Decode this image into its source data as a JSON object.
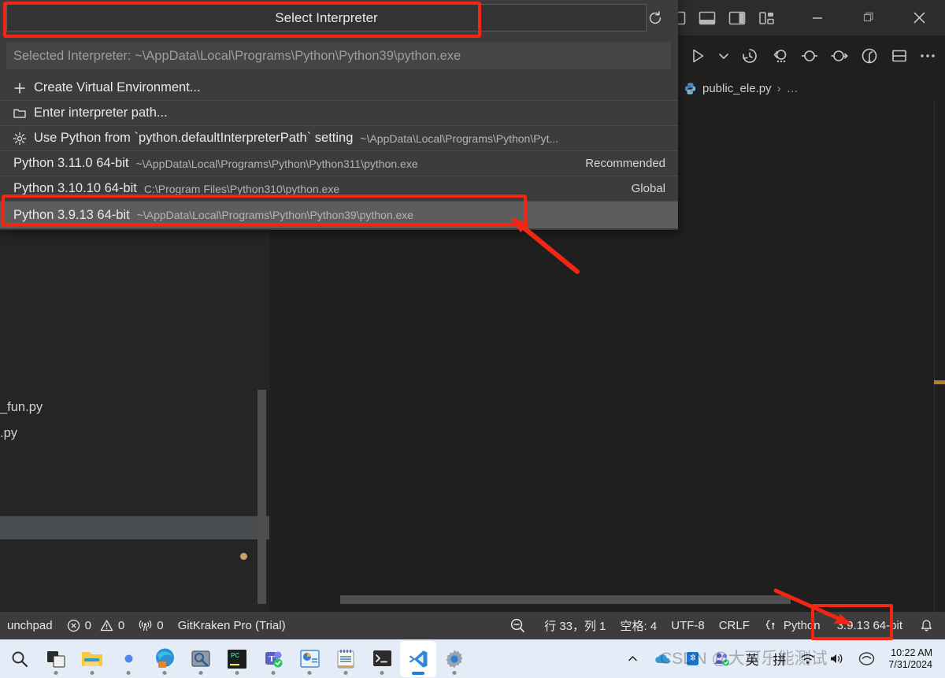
{
  "window": {
    "layout_icons": [
      "toggle-primary-sidebar-icon",
      "toggle-panel-icon",
      "toggle-secondary-sidebar-icon",
      "customize-layout-icon"
    ],
    "minimize_label": "─",
    "maximize_label": "❐",
    "close_label": "✕"
  },
  "toolbar": {
    "run_label": "run-python-file",
    "run_dropdown_label": "run-options",
    "icons": [
      "run-icon",
      "chevron-down-icon",
      "timeline-icon",
      "run-by-line-icon",
      "step-icon",
      "step-over-icon",
      "debug-icon",
      "split-editor-icon",
      "more-actions-icon"
    ]
  },
  "breadcrumb": {
    "leading_chevron": "›",
    "file_icon": "python-file-icon",
    "file": "public_ele.py",
    "separator": "›",
    "ellipsis": "…"
  },
  "quickpick": {
    "title": "Select Interpreter",
    "refresh_icon": "refresh-icon",
    "selected_interpreter": "Selected Interpreter: ~\\AppData\\Local\\Programs\\Python\\Python39\\python.exe",
    "items": [
      {
        "icon": "plus-icon",
        "label": "Create Virtual Environment...",
        "description": "",
        "right": "",
        "selected": false
      },
      {
        "icon": "folder-icon",
        "label": "Enter interpreter path...",
        "description": "",
        "right": "",
        "selected": false
      },
      {
        "icon": "gear-icon",
        "label": "Use Python from `python.defaultInterpreterPath` setting",
        "description": "~\\AppData\\Local\\Programs\\Python\\Pyt...",
        "right": "",
        "selected": false
      },
      {
        "icon": "",
        "label": "Python 3.11.0 64-bit",
        "description": "~\\AppData\\Local\\Programs\\Python\\Python311\\python.exe",
        "right": "Recommended",
        "selected": false
      },
      {
        "icon": "",
        "label": "Python 3.10.10 64-bit",
        "description": "C:\\Program Files\\Python310\\python.exe",
        "right": "Global",
        "selected": false
      },
      {
        "icon": "",
        "label": "Python 3.9.13 64-bit",
        "description": "~\\AppData\\Local\\Programs\\Python\\Python39\\python.exe",
        "right": "",
        "selected": true
      }
    ]
  },
  "sidebar": {
    "files": [
      "_fun.py",
      ".py"
    ]
  },
  "statusbar": {
    "launchpad": "unchpad",
    "errors_icon": "error-circle-icon",
    "errors": "0",
    "warnings_icon": "warning-triangle-icon",
    "warnings": "0",
    "ports_icon": "radio-tower-icon",
    "ports": "0",
    "gitkraken": "GitKraken Pro (Trial)",
    "zoom_out_icon": "zoom-out-icon",
    "cursor_position": "行 33，列 1",
    "indentation": "空格: 4",
    "encoding": "UTF-8",
    "eol": "CRLF",
    "language_icon": "python-brackets-icon",
    "language": "Python",
    "interpreter": "3.9.13 64-bit",
    "bell_icon": "bell-icon"
  },
  "taskbar": {
    "apps": [
      {
        "name": "search-icon",
        "running": false
      },
      {
        "name": "task-view-icon",
        "running": true
      },
      {
        "name": "file-explorer-icon",
        "running": true
      },
      {
        "name": "microsoft-365-icon",
        "running": true
      },
      {
        "name": "microsoft-edge-icon",
        "running": true
      },
      {
        "name": "snipaste-icon",
        "running": true
      },
      {
        "name": "pycharm-icon",
        "running": true
      },
      {
        "name": "microsoft-teams-icon",
        "running": true
      },
      {
        "name": "powerpoint-icon",
        "running": true
      },
      {
        "name": "notepad-icon",
        "running": true
      },
      {
        "name": "terminal-icon",
        "running": true
      },
      {
        "name": "vscode-icon",
        "running": true,
        "active": true
      },
      {
        "name": "settings-icon",
        "running": true
      }
    ],
    "tray": {
      "chevron_up": "show-hidden-icons",
      "onedrive": "onedrive-icon",
      "bluetooth": "bluetooth-icon",
      "teams": "teams-tray-icon",
      "ime_lang": "英",
      "ime_mode": "拼",
      "network": "network-icon",
      "volume": "volume-icon",
      "ime_tool": "ime-tool-icon"
    },
    "clock": {
      "time": "10:22 AM",
      "date": "7/31/2024"
    }
  },
  "watermark": "CSDN @大可乐能测试",
  "colors": {
    "annotation": "#f22613",
    "editor_bg": "#1f1f1f",
    "sidebar_bg": "#252526",
    "statusbar_bg": "#3c3c3c",
    "quickpick_bg": "#3c3c3c",
    "quickpick_selected": "#5d5d5d",
    "taskbar_bg": "#e4ecf7"
  }
}
